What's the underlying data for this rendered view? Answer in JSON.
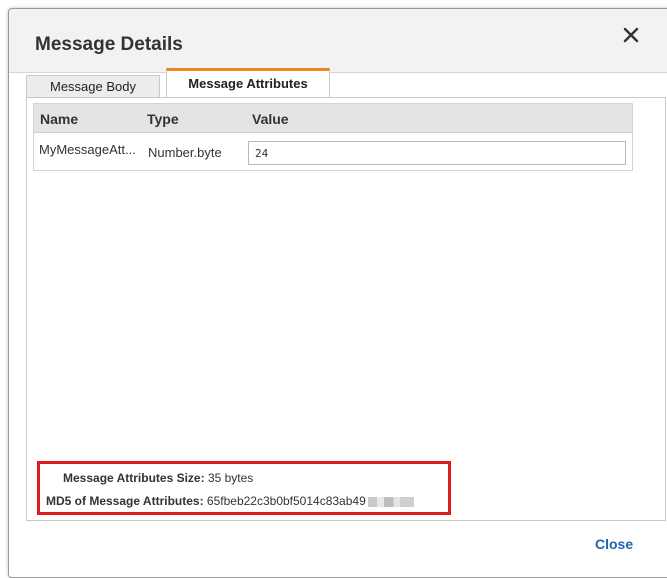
{
  "dialog": {
    "title": "Message Details",
    "close_icon": "close-icon"
  },
  "tabs": [
    {
      "label": "Message Body",
      "active": false
    },
    {
      "label": "Message Attributes",
      "active": true
    }
  ],
  "table": {
    "headers": [
      "Name",
      "Type",
      "Value"
    ],
    "rows": [
      {
        "name": "MyMessageAtt...",
        "type": "Number.byte",
        "value": "24"
      }
    ]
  },
  "summary": {
    "size_label": "Message Attributes Size:",
    "size_value": "35 bytes",
    "md5_label": "MD5 of Message Attributes:",
    "md5_value": "65fbeb22c3b0bf5014c83ab49"
  },
  "footer": {
    "close_label": "Close"
  },
  "colors": {
    "accent_tab": "#e8881c",
    "highlight_box": "#e01b1b",
    "link": "#1f64b0"
  }
}
